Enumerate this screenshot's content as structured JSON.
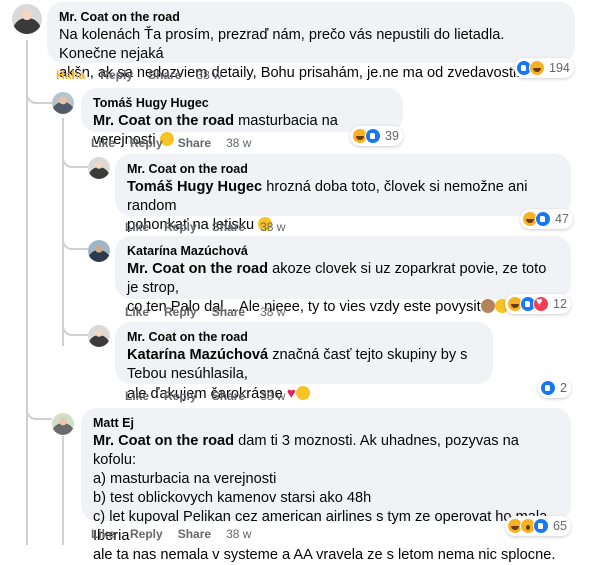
{
  "comments": [
    {
      "author": "Mr. Coat on the road",
      "text": "Na kolenách Ťa prosím, prezraď nám, prečo vás nepustili do lietadla. Konečne nejaká\nakšn, ak sa nedozviem detaily, Bohu prisahám, je.ne ma od zvedavosti!",
      "actions": {
        "react": "Haha",
        "reply": "Reply",
        "share": "Share",
        "time": "38 w"
      },
      "reactions": {
        "types": [
          "like-icon",
          "haha-icon"
        ],
        "count": "194"
      }
    },
    {
      "author": "Tomáš Hugy Hugec",
      "mention": "Mr. Coat on the road",
      "text": "masturbacia na verejnosti",
      "actions": {
        "react": "Like",
        "reply": "Reply",
        "share": "Share",
        "time": "38 w"
      },
      "reactions": {
        "types": [
          "haha-icon",
          "like-icon"
        ],
        "count": "39"
      }
    },
    {
      "author": "Mr. Coat on the road",
      "mention": "Tomáš Hugy Hugec",
      "text": "hrozná doba toto, človek si nemožne ani random\npohonkať na letisku",
      "actions": {
        "react": "Like",
        "reply": "Reply",
        "share": "Share",
        "time": "38 w"
      },
      "reactions": {
        "types": [
          "haha-icon",
          "like-icon"
        ],
        "count": "47"
      }
    },
    {
      "author": "Katarína Mazúchová",
      "mention": "Mr. Coat on the road",
      "text": "akoze clovek si uz zoparkrat povie, ze toto je strop,\nco ten Palo dal... Ale nieee, ty to vies vzdy este povysit",
      "actions": {
        "react": "Like",
        "reply": "Reply",
        "share": "Share",
        "time": "38 w"
      },
      "reactions": {
        "types": [
          "haha-icon",
          "like-icon",
          "love-icon"
        ],
        "count": "12"
      }
    },
    {
      "author": "Mr. Coat on the road",
      "mention": "Katarína Mazúchová",
      "text": "značná časť tejto skupiny by s Tebou nesúhlasila,\nale ďakujem čarokrásne",
      "actions": {
        "react": "Like",
        "reply": "Reply",
        "share": "Share",
        "time": "38 w"
      },
      "reactions": {
        "types": [
          "like-icon"
        ],
        "count": "2"
      }
    },
    {
      "author": "Matt Ej",
      "mention": "Mr. Coat on the road",
      "text": "dam ti 3 moznosti. Ak uhadnes, pozyvas na kofolu:\na) masturbacia na verejnosti\nb) test oblickovych kamenov starsi ako 48h\nc) let kupoval Pelikan cez american airlines s tym ze operovat ho mala Iberia\nale ta nas nemala v systeme a AA vravela ze s letom nema nic splocne.",
      "actions": {
        "react": "Like",
        "reply": "Reply",
        "share": "Share",
        "time": "38 w"
      },
      "reactions": {
        "types": [
          "haha-icon",
          "wow-icon",
          "like-icon"
        ],
        "count": "65"
      }
    }
  ]
}
